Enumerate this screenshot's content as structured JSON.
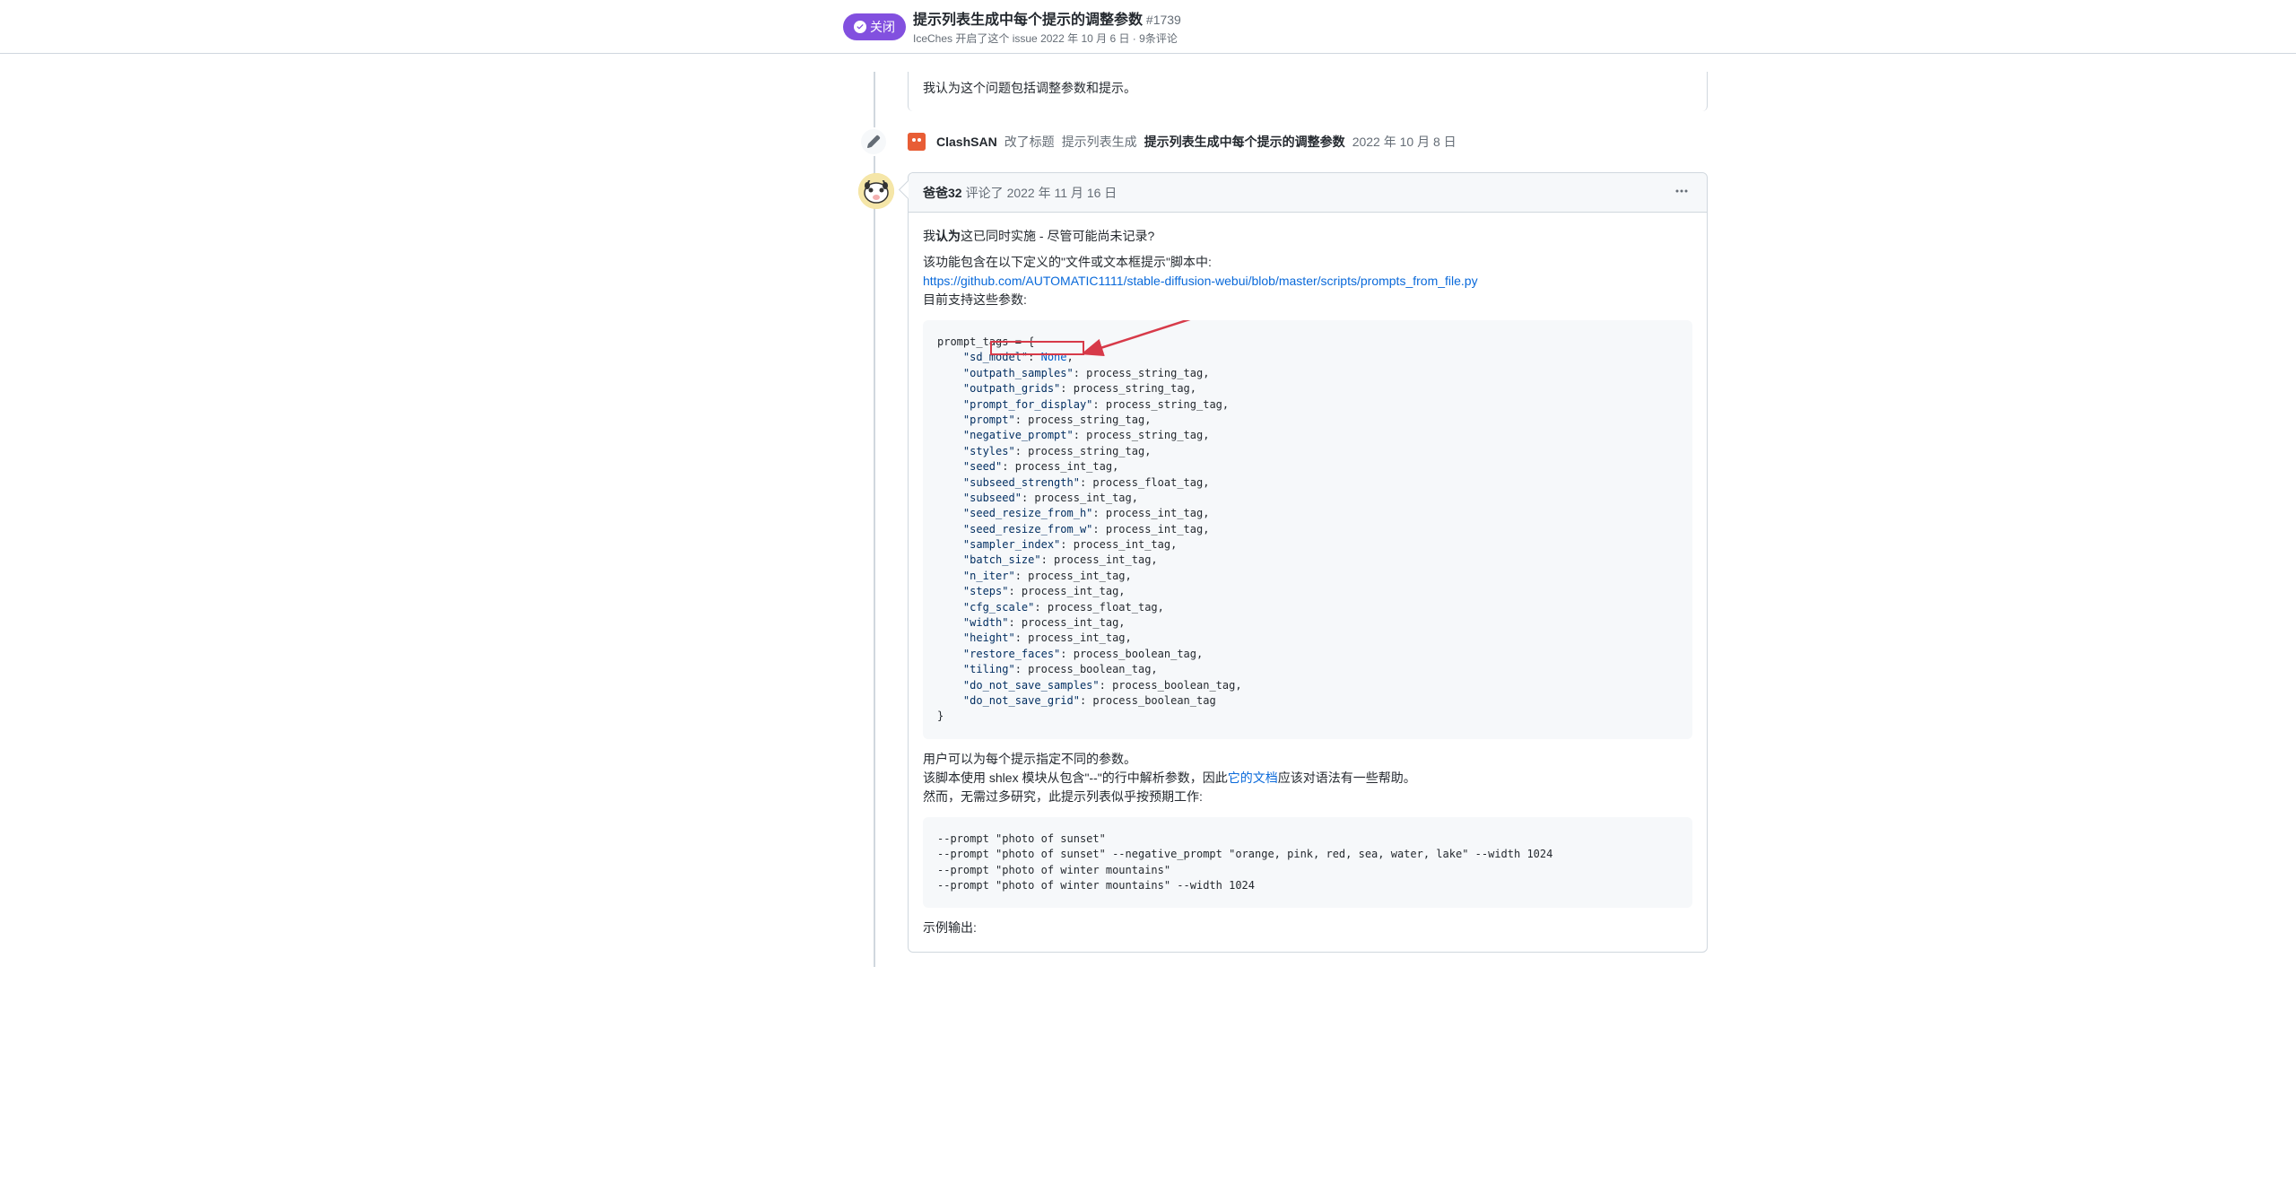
{
  "header": {
    "badge": "关闭",
    "title": "提示列表生成中每个提示的调整参数",
    "issue_number": "#1739",
    "meta_author": "IceChes",
    "meta_text": "开启了这个 issue",
    "meta_date": "2022 年 10 月 6 日",
    "meta_comments": "9条评论"
  },
  "first_comment": {
    "text": "我认为这个问题包括调整参数和提示。"
  },
  "title_event": {
    "user": "ClashSAN",
    "action": "改了标题",
    "old_title": "提示列表生成",
    "new_title": "提示列表生成中每个提示的调整参数",
    "date": "2022 年 10 月 8 日"
  },
  "comment": {
    "author": "爸爸32",
    "action": "评论了",
    "date": "2022 年 11 月 16 日",
    "para1_prefix": "我",
    "para1_bold": "认为",
    "para1_suffix": "这已同时实施 - 尽管可能尚未记录?",
    "para2": "该功能包含在以下定义的\"文件或文本框提示\"脚本中:",
    "link": "https://github.com/AUTOMATIC1111/stable-diffusion-webui/blob/master/scripts/prompts_from_file.py",
    "para3": "目前支持这些参数:",
    "para4": "用户可以为每个提示指定不同的参数。",
    "para5_prefix": "该脚本使用 shlex 模块从包含\"--\"的行中解析参数，因此",
    "para5_link": "它的文档",
    "para5_suffix": "应该对语法有一些帮助。",
    "para6": "然而，无需过多研究，此提示列表似乎按预期工作:",
    "para7": "示例输出:"
  },
  "code1_lines": [
    {
      "indent": 0,
      "text": "prompt_tags = {"
    },
    {
      "indent": 1,
      "key": "\"sd_model\"",
      "sep": ": ",
      "val": "None",
      "tail": ","
    },
    {
      "indent": 1,
      "key": "\"outpath_samples\"",
      "sep": ": ",
      "plain": "process_string_tag,"
    },
    {
      "indent": 1,
      "key": "\"outpath_grids\"",
      "sep": ": ",
      "plain": "process_string_tag,"
    },
    {
      "indent": 1,
      "key": "\"prompt_for_display\"",
      "sep": ": ",
      "plain": "process_string_tag,"
    },
    {
      "indent": 1,
      "key": "\"prompt\"",
      "sep": ": ",
      "plain": "process_string_tag,"
    },
    {
      "indent": 1,
      "key": "\"negative_prompt\"",
      "sep": ": ",
      "plain": "process_string_tag,"
    },
    {
      "indent": 1,
      "key": "\"styles\"",
      "sep": ": ",
      "plain": "process_string_tag,"
    },
    {
      "indent": 1,
      "key": "\"seed\"",
      "sep": ": ",
      "plain": "process_int_tag,"
    },
    {
      "indent": 1,
      "key": "\"subseed_strength\"",
      "sep": ": ",
      "plain": "process_float_tag,"
    },
    {
      "indent": 1,
      "key": "\"subseed\"",
      "sep": ": ",
      "plain": "process_int_tag,"
    },
    {
      "indent": 1,
      "key": "\"seed_resize_from_h\"",
      "sep": ": ",
      "plain": "process_int_tag,"
    },
    {
      "indent": 1,
      "key": "\"seed_resize_from_w\"",
      "sep": ": ",
      "plain": "process_int_tag,"
    },
    {
      "indent": 1,
      "key": "\"sampler_index\"",
      "sep": ": ",
      "plain": "process_int_tag,"
    },
    {
      "indent": 1,
      "key": "\"batch_size\"",
      "sep": ": ",
      "plain": "process_int_tag,"
    },
    {
      "indent": 1,
      "key": "\"n_iter\"",
      "sep": ": ",
      "plain": "process_int_tag,"
    },
    {
      "indent": 1,
      "key": "\"steps\"",
      "sep": ": ",
      "plain": "process_int_tag,"
    },
    {
      "indent": 1,
      "key": "\"cfg_scale\"",
      "sep": ": ",
      "plain": "process_float_tag,"
    },
    {
      "indent": 1,
      "key": "\"width\"",
      "sep": ": ",
      "plain": "process_int_tag,"
    },
    {
      "indent": 1,
      "key": "\"height\"",
      "sep": ": ",
      "plain": "process_int_tag,"
    },
    {
      "indent": 1,
      "key": "\"restore_faces\"",
      "sep": ": ",
      "plain": "process_boolean_tag,"
    },
    {
      "indent": 1,
      "key": "\"tiling\"",
      "sep": ": ",
      "plain": "process_boolean_tag,"
    },
    {
      "indent": 1,
      "key": "\"do_not_save_samples\"",
      "sep": ": ",
      "plain": "process_boolean_tag,"
    },
    {
      "indent": 1,
      "key": "\"do_not_save_grid\"",
      "sep": ": ",
      "plain": "process_boolean_tag"
    },
    {
      "indent": 0,
      "text": "}"
    }
  ],
  "code2": "--prompt \"photo of sunset\"\n--prompt \"photo of sunset\" --negative_prompt \"orange, pink, red, sea, water, lake\" --width 1024\n--prompt \"photo of winter mountains\"\n--prompt \"photo of winter mountains\" --width 1024"
}
